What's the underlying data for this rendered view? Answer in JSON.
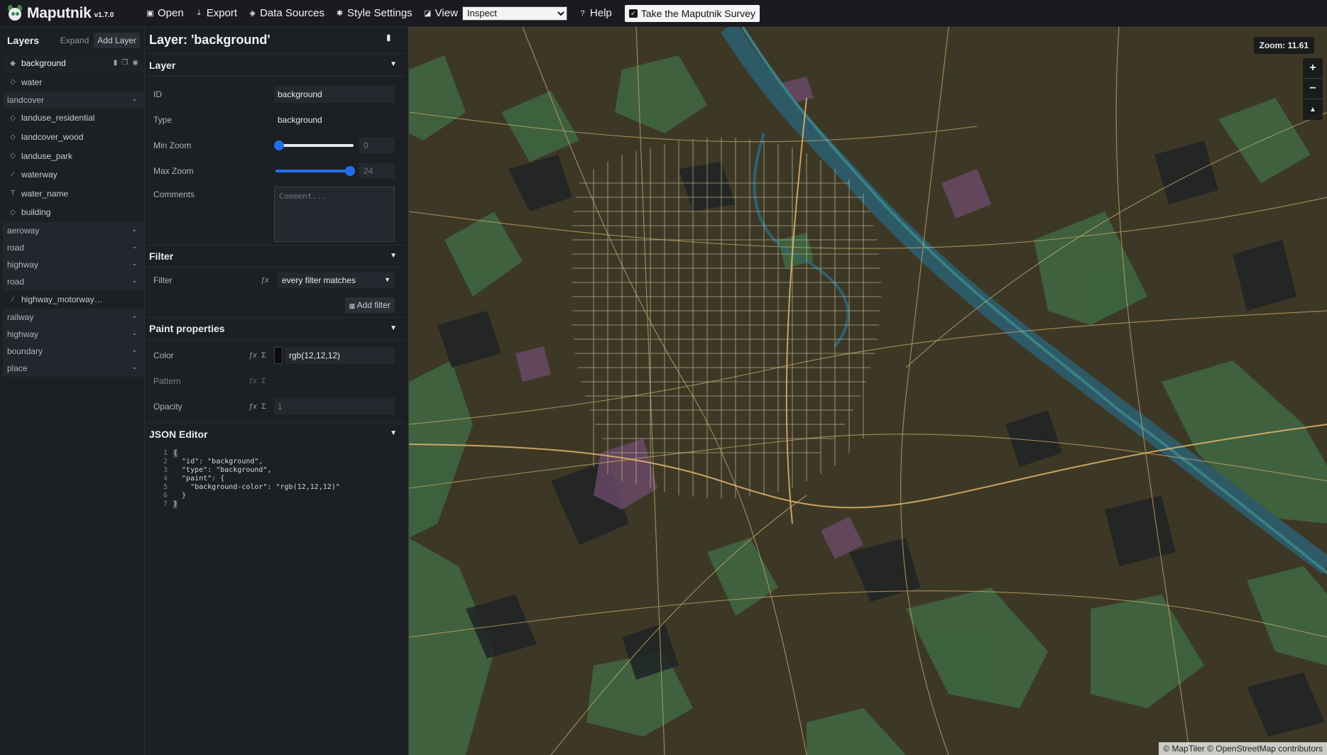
{
  "toolbar": {
    "app_name": "Maputnik",
    "version": "v1.7.0",
    "open": "Open",
    "export": "Export",
    "data_sources": "Data Sources",
    "style_settings": "Style Settings",
    "view": "View",
    "view_selected": "Inspect",
    "help": "Help",
    "survey": "Take the Maputnik Survey"
  },
  "layers_panel": {
    "title": "Layers",
    "expand": "Expand",
    "add_layer": "Add Layer",
    "items": [
      {
        "type": "layer",
        "label": "background",
        "icon": "diamond-filled-icon",
        "active": true
      },
      {
        "type": "layer",
        "label": "water",
        "icon": "diamond-outline-icon"
      },
      {
        "type": "group",
        "label": "landcover"
      },
      {
        "type": "layer",
        "label": "landuse_residential",
        "icon": "diamond-outline-icon"
      },
      {
        "type": "layer",
        "label": "landcover_wood",
        "icon": "diamond-outline-icon"
      },
      {
        "type": "layer",
        "label": "landuse_park",
        "icon": "diamond-outline-icon"
      },
      {
        "type": "layer",
        "label": "waterway",
        "icon": "line-icon"
      },
      {
        "type": "layer",
        "label": "water_name",
        "icon": "text-icon"
      },
      {
        "type": "layer",
        "label": "building",
        "icon": "diamond-outline-icon"
      },
      {
        "type": "group",
        "label": "aeroway"
      },
      {
        "type": "group",
        "label": "road"
      },
      {
        "type": "group",
        "label": "highway"
      },
      {
        "type": "group",
        "label": "road"
      },
      {
        "type": "layer",
        "label": "highway_motorway…",
        "icon": "line-icon"
      },
      {
        "type": "group",
        "label": "railway"
      },
      {
        "type": "group",
        "label": "highway"
      },
      {
        "type": "group",
        "label": "boundary"
      },
      {
        "type": "group",
        "label": "place"
      }
    ]
  },
  "editor": {
    "title": "Layer: 'background'",
    "layer_section": {
      "heading": "Layer",
      "id_label": "ID",
      "id_value": "background",
      "type_label": "Type",
      "type_value": "background",
      "minzoom_label": "Min Zoom",
      "minzoom_value": "0",
      "minzoom_fraction": 0,
      "maxzoom_label": "Max Zoom",
      "maxzoom_value": "24",
      "maxzoom_fraction": 1,
      "comments_label": "Comments",
      "comments_placeholder": "Comment..."
    },
    "filter_section": {
      "heading": "Filter",
      "filter_label": "Filter",
      "filter_value": "every filter matches",
      "add_filter": "Add filter"
    },
    "paint_section": {
      "heading": "Paint properties",
      "color_label": "Color",
      "color_value": "rgb(12,12,12)",
      "color_hex": "#0c0c0c",
      "pattern_label": "Pattern",
      "pattern_value": "",
      "opacity_label": "Opacity",
      "opacity_value": "1"
    },
    "json_section": {
      "heading": "JSON Editor",
      "lines": [
        {
          "n": "1",
          "t": "{"
        },
        {
          "n": "2",
          "t": "  \"id\": \"background\","
        },
        {
          "n": "3",
          "t": "  \"type\": \"background\","
        },
        {
          "n": "4",
          "t": "  \"paint\": {"
        },
        {
          "n": "5",
          "t": "    \"background-color\": \"rgb(12,12,12)\""
        },
        {
          "n": "6",
          "t": "  }"
        },
        {
          "n": "7",
          "t": "}"
        }
      ]
    }
  },
  "map": {
    "zoom_label": "Zoom: 11.61",
    "zoom_in": "+",
    "zoom_out": "−",
    "compass": "▲",
    "attribution": "© MapTiler © OpenStreetMap contributors"
  }
}
